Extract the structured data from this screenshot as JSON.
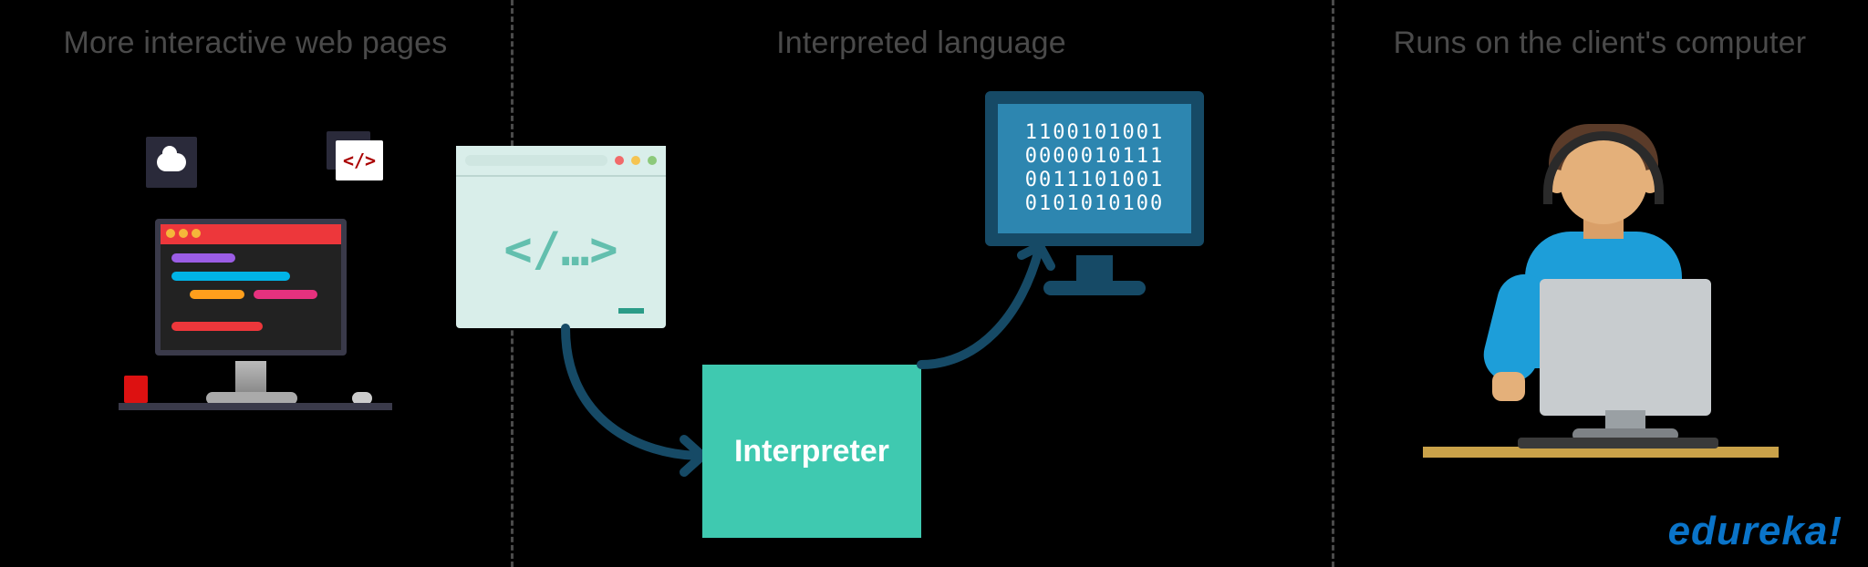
{
  "panels": {
    "p1": {
      "heading": "More interactive web pages"
    },
    "p2": {
      "heading": "Interpreted language",
      "box_label": "Interpreter",
      "code_glyph": "</…>"
    },
    "p3": {
      "heading": "Runs on the client's computer"
    }
  },
  "binary_lines": "1100101001\n0000010111\n0011101001\n0101010100",
  "brand": "edureka!",
  "code_icon_glyph": "</>"
}
